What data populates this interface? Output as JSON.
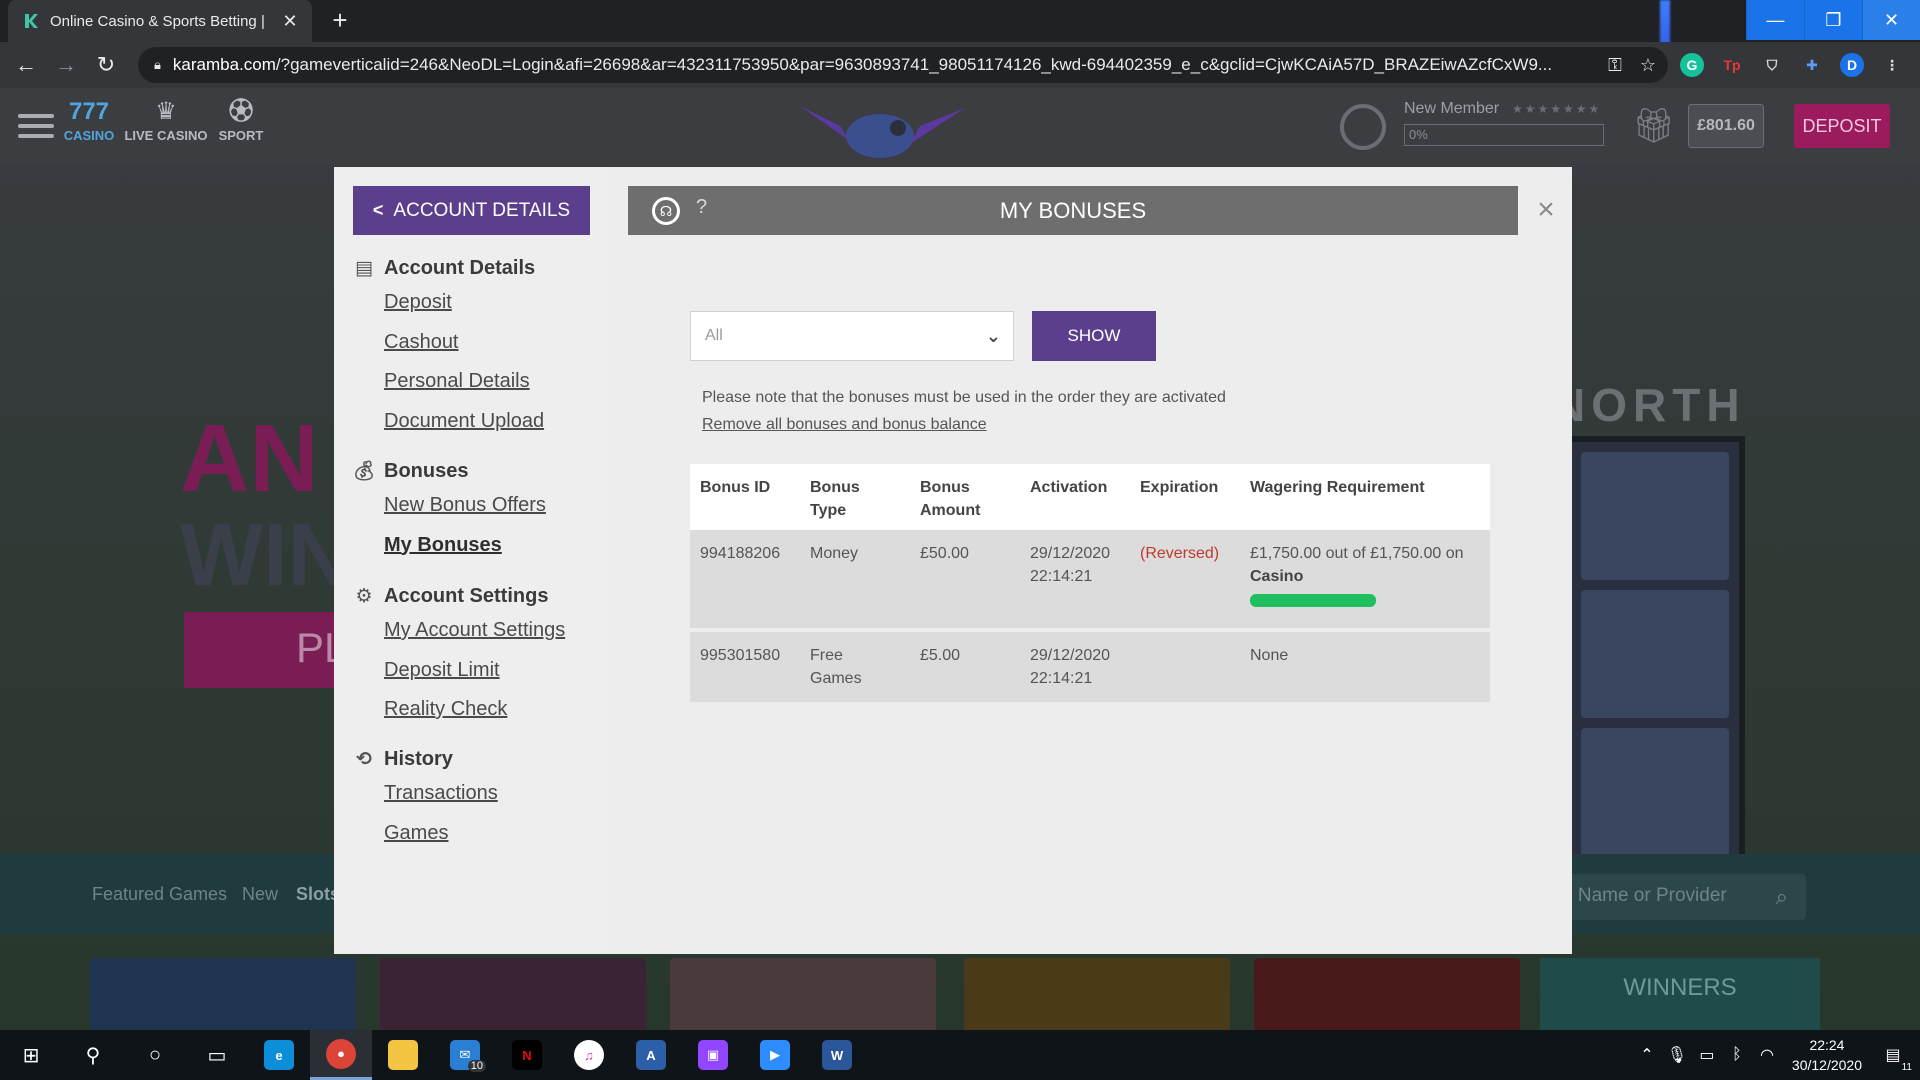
{
  "browser": {
    "tab_title": "Online Casino & Sports Betting |",
    "url_host": "karamba.com",
    "url_rest": "/?gameverticalid=246&NeoDL=Login&afi=26698&ar=432311753950&par=9630893741_98051174126_kwd-694402359_e_c&gclid=CjwKCAiA57D_BRAZEiwAZcfCxW9...",
    "profile_initial": "D"
  },
  "site": {
    "nav": [
      {
        "label": "CASINO",
        "icon": "slots-icon"
      },
      {
        "label": "LIVE CASINO",
        "icon": "dealer-icon"
      },
      {
        "label": "SPORT",
        "icon": "ball-icon"
      }
    ],
    "member_label": "New Member",
    "member_progress": "0%",
    "balance": "£801.60",
    "deposit_label": "DEPOSIT"
  },
  "background": {
    "hero_line1": "AN",
    "hero_line2": "WIN",
    "hero_button": "PL",
    "slot_title": "NORTH",
    "tabs": [
      "Featured Games",
      "New",
      "Slots"
    ],
    "search_placeholder": "e Name or Provider",
    "winners_label": "WINNERS"
  },
  "modal": {
    "back_label": "ACCOUNT DETAILS",
    "title": "MY BONUSES",
    "sidebar": {
      "account_details": {
        "heading": "Account Details",
        "links": [
          "Deposit",
          "Cashout",
          "Personal Details",
          "Document Upload"
        ]
      },
      "bonuses": {
        "heading": "Bonuses",
        "links": [
          "New Bonus Offers",
          "My Bonuses"
        ]
      },
      "account_settings": {
        "heading": "Account Settings",
        "links": [
          "My Account Settings",
          "Deposit Limit",
          "Reality Check"
        ]
      },
      "history": {
        "heading": "History",
        "links": [
          "Transactions",
          "Games"
        ]
      }
    },
    "filter_value": "All",
    "show_label": "SHOW",
    "note": "Please note that the bonuses must be used in the order they are activated",
    "remove_link": "Remove all bonuses and bonus balance",
    "table": {
      "headers": [
        "Bonus ID",
        "Bonus Type",
        "Bonus Amount",
        "Activation",
        "Expiration",
        "Wagering Requirement"
      ],
      "rows": [
        {
          "id": "994188206",
          "type": "Money",
          "amount": "£50.00",
          "activation_date": "29/12/2020",
          "activation_time": "22:14:21",
          "expiration": "(Reversed)",
          "wagering": "£1,750.00 out of £1,750.00 on",
          "wagering_game": "Casino",
          "wagering_progress": 1.0
        },
        {
          "id": "995301580",
          "type_line1": "Free",
          "type_line2": "Games",
          "amount": "£5.00",
          "activation_date": "29/12/2020",
          "activation_time": "22:14:21",
          "expiration": "",
          "wagering": "None"
        }
      ]
    }
  },
  "taskbar": {
    "mail_badge": "10",
    "time": "22:24",
    "date": "30/12/2020",
    "notification_badge": "11"
  },
  "colors": {
    "primary_purple": "#5c3f8c",
    "deposit_pink": "#9b1b5e",
    "progress_green": "#1fbf5f",
    "reversed_red": "#c0392b"
  }
}
